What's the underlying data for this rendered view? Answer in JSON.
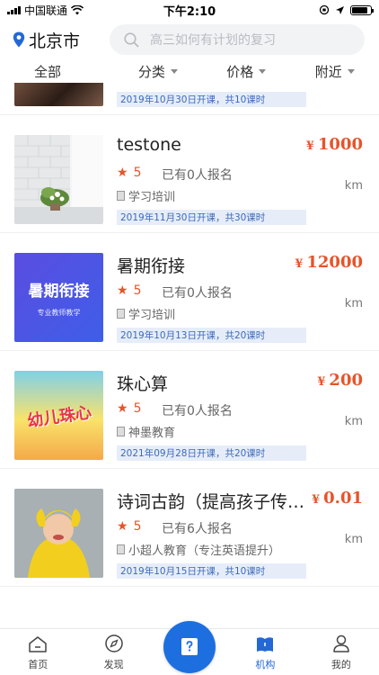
{
  "status_bar": {
    "carrier": "中国联通",
    "time": "下午2:10"
  },
  "header": {
    "city": "北京市",
    "search_placeholder": "高三如何有计划的复习"
  },
  "filters": [
    {
      "label": "全部",
      "has_arrow": false
    },
    {
      "label": "分类",
      "has_arrow": true
    },
    {
      "label": "价格",
      "has_arrow": true
    },
    {
      "label": "附近",
      "has_arrow": true
    }
  ],
  "courses": [
    {
      "title": "",
      "price": "",
      "rating": "",
      "enrolled": "",
      "org": "",
      "distance": "",
      "schedule": "2019年10月30日开课，共10课时",
      "thumb": "dark-photo"
    },
    {
      "title": "testone",
      "price": "1000",
      "rating": "5",
      "enrolled": "已有0人报名",
      "org": "学习培训",
      "distance": "km",
      "schedule": "2019年11月30日开课，共30课时",
      "thumb": "room-photo"
    },
    {
      "title": "暑期衔接",
      "price": "12000",
      "rating": "5",
      "enrolled": "已有0人报名",
      "org": "学习培训",
      "distance": "km",
      "schedule": "2019年10月13日开课，共20课时",
      "thumb": "summer-banner",
      "thumb_title": "暑期衔接",
      "thumb_sub": "专业教师教学"
    },
    {
      "title": "珠心算",
      "price": "200",
      "rating": "5",
      "enrolled": "已有0人报名",
      "org": "神墨教育",
      "distance": "km",
      "schedule": "2021年09月28日开课，共20课时",
      "thumb": "kids-book",
      "thumb_title": "幼儿珠心"
    },
    {
      "title": "诗词古韵（提高孩子传…",
      "price": "0.01",
      "rating": "5",
      "enrolled": "已有6人报名",
      "org": "小超人教育（专注英语提升）",
      "distance": "km",
      "schedule": "2019年10月15日开课，共10课时",
      "thumb": "child-photo"
    }
  ],
  "currency_symbol": "¥",
  "tabbar": [
    {
      "label": "首页",
      "icon": "home-icon",
      "active": false
    },
    {
      "label": "发现",
      "icon": "compass-icon",
      "active": false
    },
    {
      "label": "",
      "icon": "question-book-icon",
      "active": false
    },
    {
      "label": "机构",
      "icon": "book-icon",
      "active": true
    },
    {
      "label": "我的",
      "icon": "user-icon",
      "active": false
    }
  ],
  "colors": {
    "accent": "#2468d6",
    "price": "#e6542a",
    "tag_bg": "#e6edf9",
    "tag_text": "#3c6ab9"
  }
}
